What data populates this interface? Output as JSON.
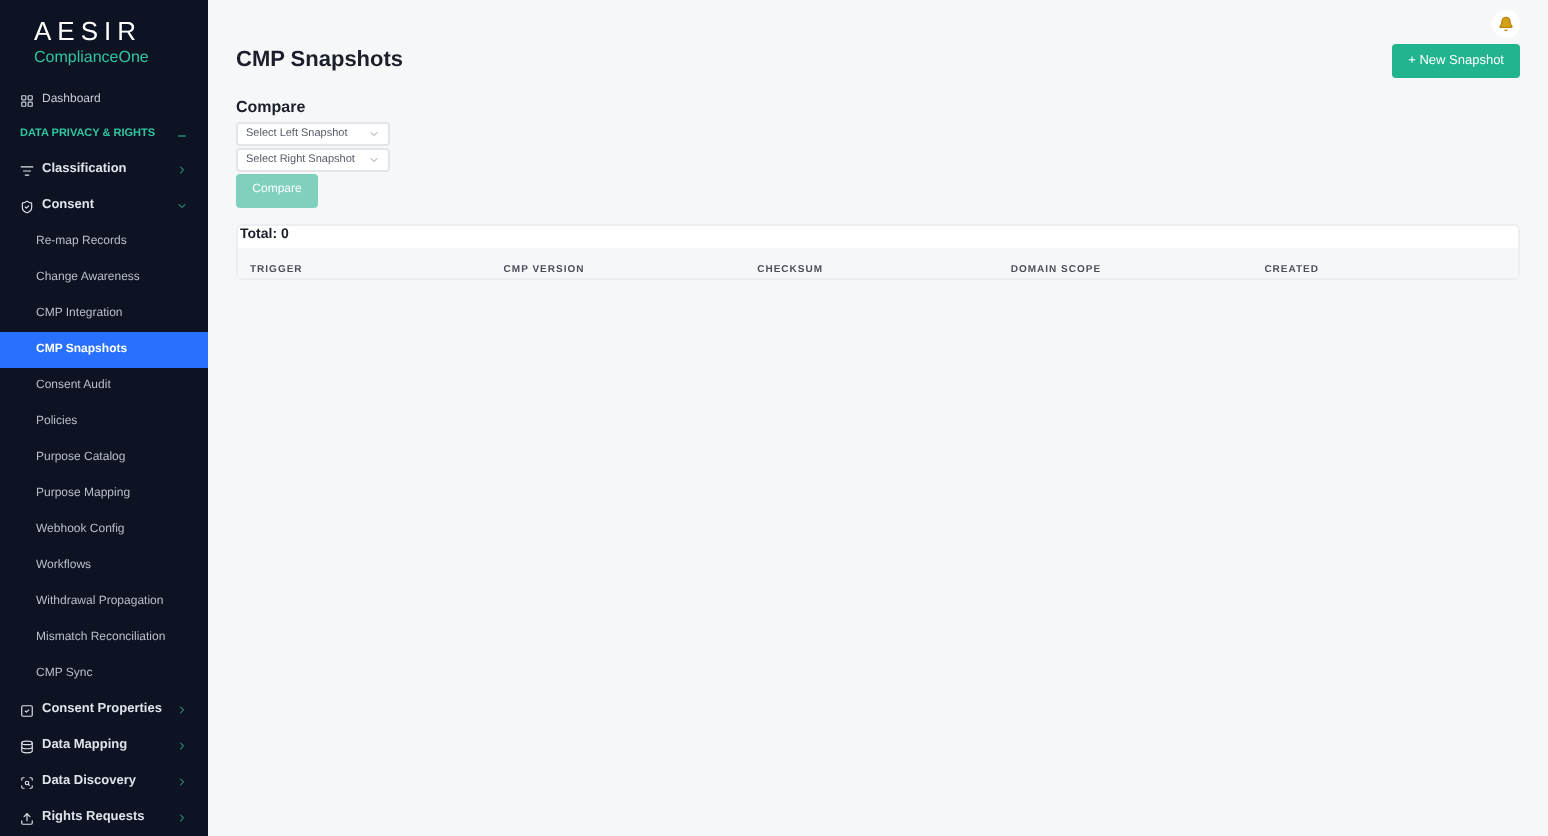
{
  "brand": {
    "name": "AESIR",
    "product": "ComplianceOne"
  },
  "sidebar": {
    "top_item": {
      "label": "Dashboard"
    },
    "section": {
      "label": "DATA PRIVACY & RIGHTS",
      "expanded": true
    },
    "groups": [
      {
        "label": "Classification",
        "expanded": false
      },
      {
        "label": "Consent",
        "expanded": true,
        "children": [
          {
            "label": "Re-map Records",
            "selected": false
          },
          {
            "label": "Change Awareness",
            "selected": false
          },
          {
            "label": "CMP Integration",
            "selected": false
          },
          {
            "label": "CMP Snapshots",
            "selected": true
          },
          {
            "label": "Consent Audit",
            "selected": false
          },
          {
            "label": "Policies",
            "selected": false
          },
          {
            "label": "Purpose Catalog",
            "selected": false
          },
          {
            "label": "Purpose Mapping",
            "selected": false
          },
          {
            "label": "Webhook Config",
            "selected": false
          },
          {
            "label": "Workflows",
            "selected": false
          },
          {
            "label": "Withdrawal Propagation",
            "selected": false
          },
          {
            "label": "Mismatch Reconciliation",
            "selected": false
          },
          {
            "label": "CMP Sync",
            "selected": false
          }
        ]
      },
      {
        "label": "Consent Properties",
        "expanded": false
      },
      {
        "label": "Data Mapping",
        "expanded": false
      },
      {
        "label": "Data Discovery",
        "expanded": false
      },
      {
        "label": "Rights Requests",
        "expanded": false
      }
    ]
  },
  "page": {
    "title": "CMP Snapshots",
    "new_button": "+ New Snapshot"
  },
  "compare": {
    "heading": "Compare",
    "left_select": {
      "placeholder": "Select Left Snapshot"
    },
    "right_select": {
      "placeholder": "Select Right Snapshot"
    },
    "button": {
      "label": "Compare",
      "disabled": true
    }
  },
  "table": {
    "total": "Total: 0",
    "columns": [
      "TRIGGER",
      "CMP VERSION",
      "CHECKSUM",
      "DOMAIN SCOPE",
      "CREATED"
    ]
  }
}
